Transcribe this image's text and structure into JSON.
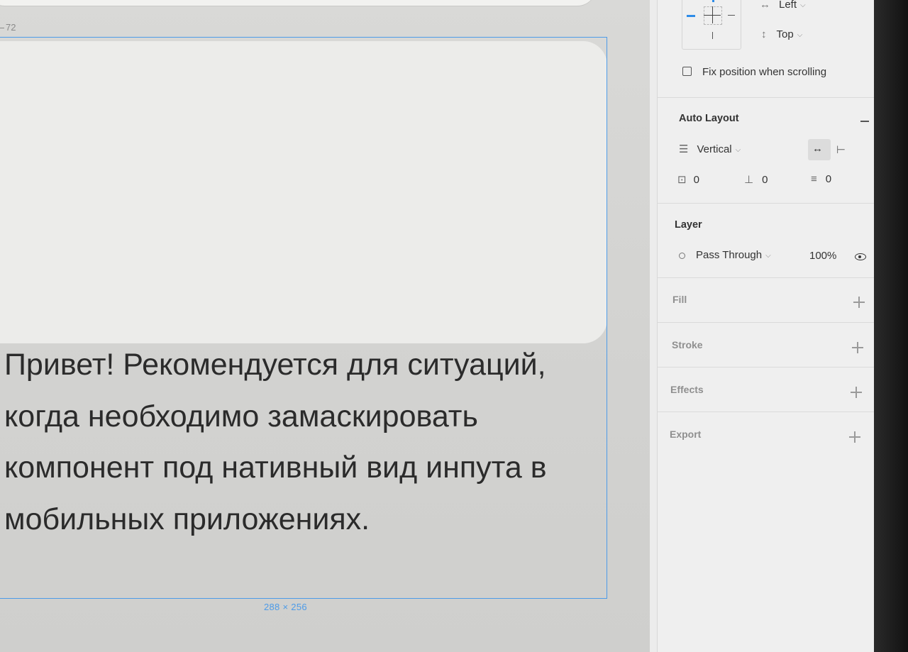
{
  "canvas": {
    "frame_label": "72",
    "body_text": "Привет! Рекомендуется для ситуаций, когда необходимо замаскировать компонент под нативный вид инпута в мобильных приложениях.",
    "dimension_badge": "288 × 256"
  },
  "panel": {
    "constraints": {
      "horizontal_value": "Left",
      "horizontal_icon": "↔",
      "vertical_value": "Top",
      "vertical_icon": "↕",
      "fix_position_label": "Fix position when scrolling",
      "fix_position_checked": false
    },
    "auto_layout": {
      "title": "Auto Layout",
      "direction": "Vertical",
      "spacing": "0",
      "padding_horizontal": "0",
      "padding_vertical": "0"
    },
    "layer": {
      "title": "Layer",
      "blend_mode": "Pass Through",
      "opacity": "100%"
    },
    "fill": {
      "title": "Fill"
    },
    "stroke": {
      "title": "Stroke"
    },
    "effects": {
      "title": "Effects"
    },
    "export": {
      "title": "Export"
    }
  },
  "colors": {
    "selection": "#4d9be8",
    "constraint_active": "#2d8ce8"
  }
}
